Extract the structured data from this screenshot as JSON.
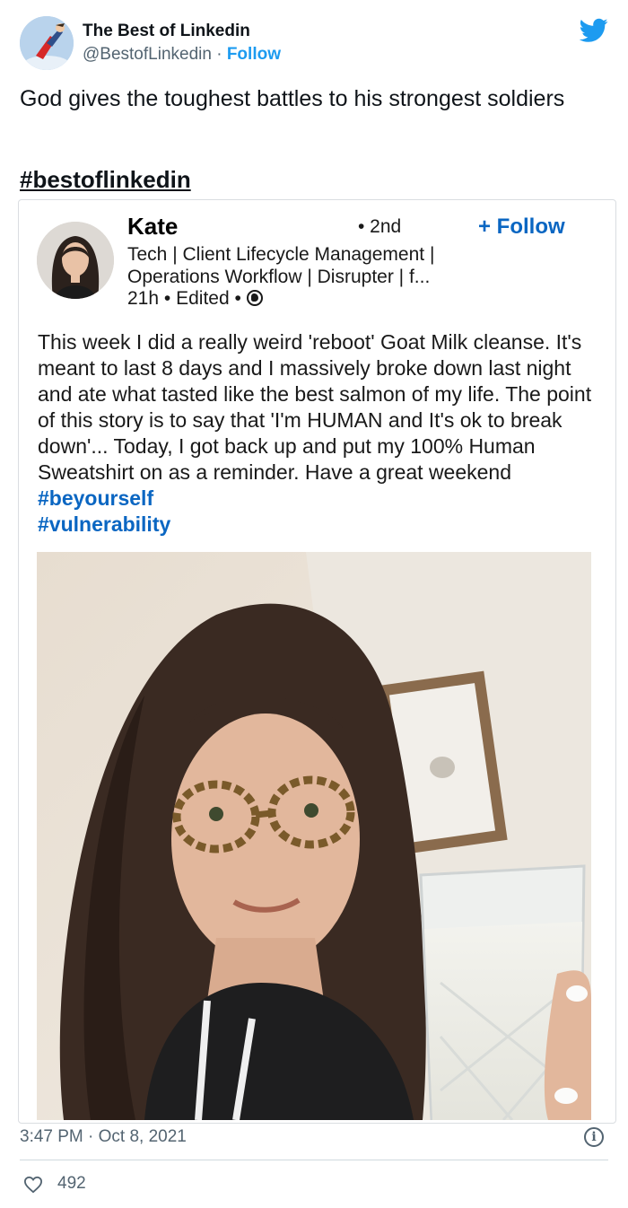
{
  "account": {
    "name": "The Best of Linkedin",
    "handle": "@BestofLinkedin",
    "separator": "·",
    "follow_label": "Follow",
    "avatar_icon": "superhero-avatar-icon",
    "brand_icon": "twitter-bird-icon",
    "brand_color": "#1d9bf0"
  },
  "tweet": {
    "text": "God gives the toughest battles to his strongest soldiers",
    "hashtag": "#bestoflinkedin"
  },
  "embedded_post": {
    "author_name": "Kate",
    "degree": "• 2nd",
    "follow_label": "+ Follow",
    "headline": "Tech | Client Lifecycle Management | Operations Workflow | Disrupter | f...",
    "time": "21h",
    "edited": "Edited",
    "dot": "•",
    "visibility_icon": "globe-icon",
    "body_text": "This week I did a really weird 'reboot' Goat Milk cleanse. It's meant to last 8 days and I massively broke down last night and ate what tasted like the best salmon of my life. The point of this story is to say that 'I'm HUMAN and It's ok to break down'... Today, I got back up and put my 100% Human Sweatshirt on as a reminder.  Have a great weekend ",
    "tags": [
      "#beyourself",
      "#vulnerability"
    ],
    "link_color": "#0a66c2"
  },
  "footer": {
    "timestamp": "3:47 PM · Oct 8, 2021",
    "info_icon": "info-icon",
    "info_glyph": "i",
    "like_icon": "heart-icon",
    "likes": "492"
  }
}
